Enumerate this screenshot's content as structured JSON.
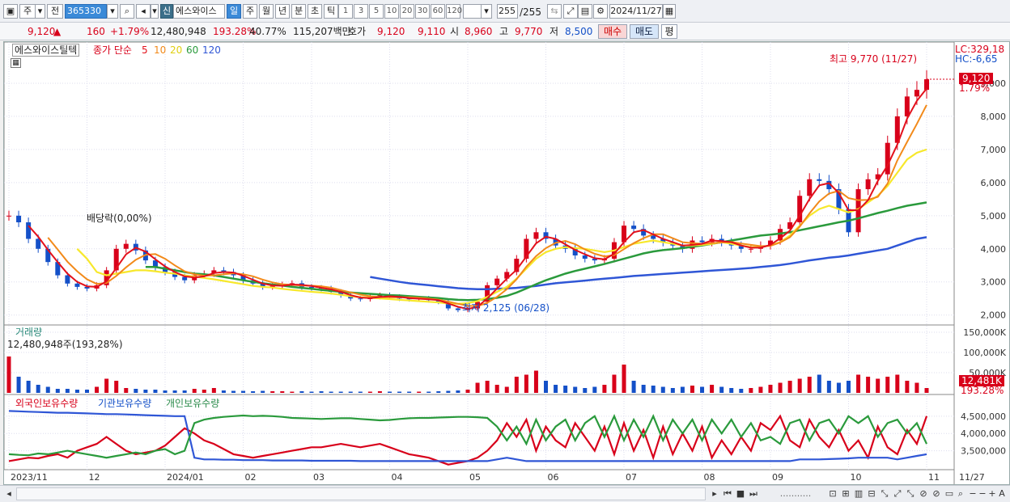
{
  "toolbar": {
    "market_tab": "주",
    "prev_label": "전",
    "stock_code": "365330",
    "new_badge": "신",
    "stock_name": "에스와이스",
    "periods": [
      "일",
      "주",
      "월",
      "년",
      "분",
      "초",
      "틱"
    ],
    "active_period": "일",
    "numbers": [
      "1",
      "3",
      "5",
      "10",
      "20",
      "30",
      "60",
      "120"
    ],
    "count": "255",
    "count_total": "/255",
    "date": "2024/11/27"
  },
  "quote": {
    "price": "9,120",
    "arrow": "▲",
    "change": "160",
    "change_pct": "+1.79%",
    "volume": "12,480,948",
    "volume_ratio": "193.28%",
    "turnover": "40.77%",
    "amount": "115,207백만",
    "bid_label": "호가",
    "bid": "9,120",
    "ask": "9,110",
    "open_label": "시",
    "open": "8,960",
    "high_label": "고",
    "high": "9,770",
    "low_label": "저",
    "low": "8,500",
    "buy": "매수",
    "sell": "매도",
    "avg": "평"
  },
  "chart_legend": {
    "name": "에스와이스틸텍",
    "ma_label": "종가 단순",
    "ma5": "5",
    "ma10": "10",
    "ma20": "20",
    "ma60": "60",
    "ma120": "120"
  },
  "price_labels": {
    "lc": "LC:329,18",
    "hc": "HC:-6,65",
    "current": "9,120",
    "current_pct": "1.79%",
    "high_note": "최고 9,770 (11/27)",
    "low_note": "최저 2,125 (06/28)",
    "dividend_note": "배당락(0,00%)"
  },
  "volume_panel": {
    "title": "거래량",
    "note": "12,480,948주(193,28%)",
    "current": "12,481K",
    "current_pct": "193.28%"
  },
  "holdings_panel": {
    "foreign": "외국인보유수량",
    "institution": "기관보유수량",
    "individual": "개인보유수량"
  },
  "colors": {
    "up": "#d8001a",
    "down": "#1450c8",
    "ma5": "#e3101b",
    "ma10": "#f28a1a",
    "ma20": "#f7e82b",
    "ma60": "#2a9a3c",
    "ma120": "#2f56d6"
  },
  "chart_data": [
    {
      "type": "candlestick",
      "title": "에스와이스틸텍",
      "y_ticks": [
        2000,
        3000,
        4000,
        5000,
        6000,
        7000,
        8000,
        9000
      ],
      "x_ticks": [
        "2023/11",
        "12",
        "2024/01",
        "02",
        "03",
        "04",
        "05",
        "06",
        "07",
        "08",
        "09",
        "10",
        "11",
        "11/27"
      ],
      "ylim": [
        1700,
        10000
      ],
      "close_series": [
        5000,
        4800,
        4300,
        4000,
        3600,
        3200,
        2950,
        2850,
        2800,
        2900,
        3350,
        4000,
        4150,
        3950,
        3650,
        3450,
        3300,
        3150,
        3050,
        3200,
        3250,
        3350,
        3300,
        3200,
        3050,
        2950,
        2850,
        2880,
        2920,
        2960,
        2850,
        2820,
        2800,
        2700,
        2600,
        2500,
        2480,
        2550,
        2600,
        2550,
        2500,
        2480,
        2500,
        2450,
        2400,
        2200,
        2150,
        2200,
        2400,
        2900,
        3100,
        3300,
        3700,
        4300,
        4500,
        4300,
        4100,
        4000,
        3800,
        3700,
        3650,
        3700,
        4200,
        4700,
        4600,
        4400,
        4300,
        4200,
        4100,
        4000,
        4250,
        4200,
        4300,
        4200,
        4100,
        4000,
        4000,
        4100,
        4250,
        4600,
        4800,
        5600,
        6100,
        6050,
        5800,
        5200,
        4500,
        5800,
        6100,
        6250,
        7200,
        8000,
        8600,
        8800,
        9120
      ],
      "ma20": [
        null,
        null,
        null,
        null,
        null,
        null,
        null,
        4000,
        3700,
        3300,
        3200,
        3250,
        3300,
        3350,
        3350,
        3320,
        3280,
        3250,
        3200,
        3160,
        3120,
        3080,
        3030,
        2980,
        2930,
        2880,
        2850,
        2830,
        2790,
        2760,
        2730,
        2700,
        2680,
        2650,
        2610,
        2570,
        2540,
        2520,
        2500,
        2480,
        2460,
        2440,
        2420,
        2400,
        2380,
        2350,
        2340,
        2360,
        2420,
        2550,
        2700,
        2850,
        3100,
        3400,
        3700,
        3900,
        4000,
        4050,
        4020,
        4000,
        3950,
        3900,
        3950,
        4050,
        4150,
        4200,
        4250,
        4200,
        4150,
        4100,
        4100,
        4120,
        4150,
        4200,
        4150,
        4100,
        4050,
        4050,
        4100,
        4200,
        4400,
        4700,
        5000,
        5200,
        5300,
        5200,
        5100,
        5200,
        5400,
        5600,
        5900,
        6300,
        6700,
        6900,
        7000
      ],
      "ma60": [
        null,
        null,
        null,
        null,
        null,
        null,
        null,
        null,
        null,
        null,
        null,
        null,
        null,
        null,
        3450,
        3450,
        3400,
        3350,
        3300,
        3250,
        3230,
        3200,
        3150,
        3100,
        3050,
        3000,
        2960,
        2920,
        2890,
        2850,
        2820,
        2790,
        2760,
        2730,
        2700,
        2680,
        2660,
        2640,
        2620,
        2600,
        2590,
        2570,
        2550,
        2530,
        2510,
        2480,
        2460,
        2450,
        2460,
        2480,
        2520,
        2580,
        2680,
        2800,
        2930,
        3050,
        3150,
        3250,
        3330,
        3400,
        3470,
        3540,
        3620,
        3700,
        3780,
        3860,
        3920,
        3960,
        3990,
        4020,
        4060,
        4100,
        4150,
        4200,
        4250,
        4300,
        4350,
        4400,
        4430,
        4460,
        4500,
        4560,
        4620,
        4680,
        4740,
        4800,
        4850,
        4920,
        5000,
        5080,
        5150,
        5230,
        5300,
        5350,
        5400
      ],
      "ma120": [
        null,
        null,
        null,
        null,
        null,
        null,
        null,
        null,
        null,
        null,
        null,
        null,
        null,
        null,
        null,
        null,
        null,
        null,
        null,
        null,
        null,
        null,
        null,
        null,
        null,
        null,
        null,
        null,
        null,
        null,
        null,
        null,
        null,
        null,
        null,
        null,
        null,
        3150,
        3100,
        3050,
        3000,
        2960,
        2930,
        2900,
        2870,
        2840,
        2810,
        2790,
        2780,
        2780,
        2790,
        2800,
        2820,
        2850,
        2880,
        2920,
        2960,
        2990,
        3010,
        3040,
        3070,
        3100,
        3120,
        3150,
        3180,
        3200,
        3220,
        3240,
        3260,
        3280,
        3300,
        3320,
        3340,
        3360,
        3380,
        3400,
        3420,
        3450,
        3480,
        3510,
        3550,
        3600,
        3650,
        3690,
        3730,
        3760,
        3800,
        3850,
        3900,
        3950,
        4000,
        4100,
        4200,
        4300,
        4350
      ]
    },
    {
      "type": "bar",
      "title": "거래량",
      "y_ticks": [
        50000,
        100000,
        150000
      ],
      "unit": "K",
      "values": [
        90,
        40,
        30,
        20,
        15,
        10,
        10,
        8,
        8,
        15,
        35,
        30,
        12,
        10,
        8,
        8,
        6,
        6,
        6,
        10,
        8,
        12,
        6,
        5,
        5,
        4,
        5,
        4,
        4,
        3,
        4,
        3,
        4,
        3,
        3,
        3,
        3,
        3,
        4,
        3,
        3,
        3,
        3,
        3,
        4,
        5,
        6,
        8,
        25,
        30,
        20,
        15,
        40,
        45,
        55,
        30,
        20,
        18,
        15,
        12,
        15,
        20,
        45,
        70,
        30,
        20,
        18,
        15,
        12,
        15,
        18,
        15,
        20,
        15,
        12,
        10,
        12,
        15,
        20,
        25,
        30,
        35,
        40,
        45,
        30,
        25,
        30,
        45,
        40,
        35,
        40,
        45,
        30,
        25,
        12
      ]
    },
    {
      "type": "line",
      "title": "보유수량",
      "y_ticks": [
        3500000,
        4000000,
        4500000
      ],
      "series": [
        {
          "name": "외국인보유수량",
          "values": [
            3200,
            3250,
            3300,
            3280,
            3350,
            3400,
            3300,
            3500,
            3600,
            3700,
            3900,
            3700,
            3500,
            3400,
            3450,
            3500,
            3650,
            3900,
            4150,
            4000,
            3800,
            3700,
            3550,
            3400,
            3350,
            3300,
            3350,
            3400,
            3450,
            3500,
            3550,
            3600,
            3600,
            3650,
            3700,
            3650,
            3600,
            3650,
            3700,
            3600,
            3500,
            3400,
            3350,
            3300,
            3200,
            3100,
            3150,
            3200,
            3300,
            3500,
            3800,
            4300,
            3900,
            4400,
            3500,
            4200,
            3800,
            3600,
            4300,
            3900,
            3500,
            4200,
            3400,
            4300,
            3500,
            4100,
            3300,
            4200,
            3400,
            4000,
            3500,
            4200,
            3300,
            3800,
            3400,
            3900,
            3500,
            4300,
            4100,
            4500,
            3800,
            3600,
            4400,
            3900,
            3600,
            4100,
            3500,
            3800,
            3300,
            4200,
            3600,
            3400,
            4100,
            3700,
            4500
          ]
        },
        {
          "name": "기관보유수량",
          "values": [
            4650,
            4640,
            4630,
            4620,
            4610,
            4600,
            4600,
            4590,
            4580,
            4570,
            4560,
            4560,
            4550,
            4540,
            4530,
            4520,
            4510,
            4500,
            4500,
            3300,
            3250,
            3250,
            3240,
            3240,
            3230,
            3230,
            3230,
            3220,
            3220,
            3220,
            3220,
            3210,
            3210,
            3210,
            3210,
            3210,
            3200,
            3200,
            3200,
            3200,
            3200,
            3200,
            3200,
            3200,
            3200,
            3200,
            3200,
            3200,
            3200,
            3200,
            3250,
            3300,
            3250,
            3200,
            3200,
            3200,
            3200,
            3200,
            3200,
            3200,
            3200,
            3200,
            3200,
            3200,
            3200,
            3200,
            3200,
            3200,
            3200,
            3200,
            3200,
            3200,
            3200,
            3200,
            3200,
            3200,
            3200,
            3200,
            3200,
            3200,
            3200,
            3250,
            3250,
            3250,
            3260,
            3270,
            3280,
            3300,
            3300,
            3300,
            3300,
            3250,
            3300,
            3350,
            3400
          ]
        },
        {
          "name": "개인보유수량",
          "values": [
            3400,
            3380,
            3370,
            3420,
            3400,
            3450,
            3500,
            3450,
            3400,
            3350,
            3300,
            3350,
            3400,
            3450,
            3400,
            3500,
            3550,
            3400,
            3500,
            4300,
            4400,
            4450,
            4480,
            4500,
            4520,
            4500,
            4510,
            4500,
            4480,
            4450,
            4440,
            4430,
            4420,
            4430,
            4440,
            4440,
            4420,
            4400,
            4380,
            4390,
            4420,
            4440,
            4450,
            4450,
            4460,
            4470,
            4480,
            4480,
            4470,
            4450,
            4200,
            3800,
            4200,
            3700,
            4400,
            3800,
            4200,
            4400,
            3800,
            4300,
            4500,
            3900,
            4500,
            3800,
            4400,
            3900,
            4500,
            3800,
            4400,
            4000,
            4400,
            3800,
            4400,
            4000,
            4400,
            3900,
            4300,
            3800,
            3900,
            3700,
            4300,
            4400,
            3800,
            4300,
            4400,
            4000,
            4500,
            4300,
            4500,
            3900,
            4300,
            4400,
            4000,
            4300,
            3700
          ]
        }
      ]
    }
  ],
  "bottombar": {
    "range_label": "..........."
  }
}
